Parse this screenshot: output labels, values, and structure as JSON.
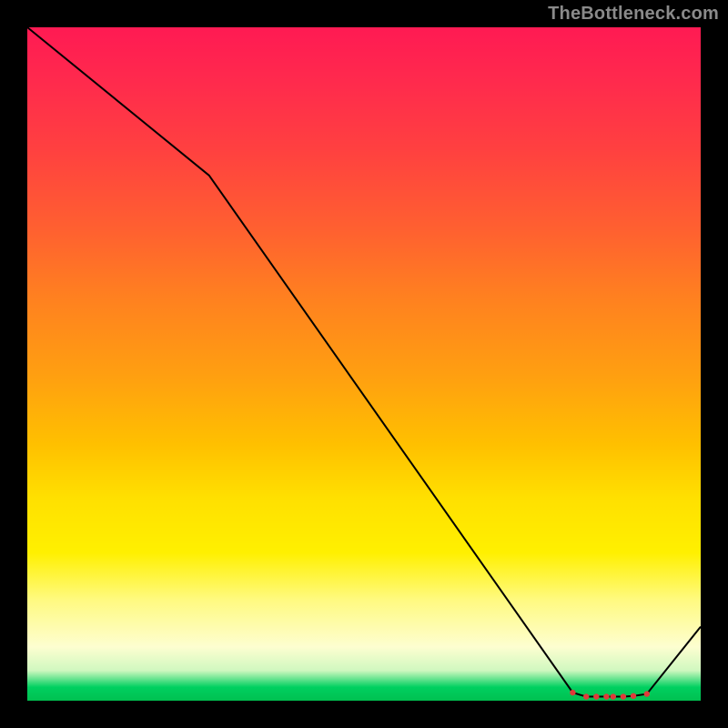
{
  "watermark": "TheBottleneck.com",
  "chart_data": {
    "type": "line",
    "title": "",
    "xlabel": "",
    "ylabel": "",
    "xlim": [
      0,
      100
    ],
    "ylim": [
      0,
      100
    ],
    "grid": false,
    "series": [
      {
        "name": "curve",
        "x": [
          0,
          27,
          81,
          83,
          84.5,
          86,
          87,
          88.5,
          90,
          92,
          100
        ],
        "y": [
          100,
          78,
          1.2,
          0.6,
          0.6,
          0.6,
          0.6,
          0.6,
          0.7,
          1.0,
          11
        ]
      }
    ],
    "markers": {
      "x": [
        81,
        83,
        84.5,
        86,
        87,
        88.5,
        90,
        92
      ],
      "y": [
        1.2,
        0.6,
        0.6,
        0.6,
        0.6,
        0.6,
        0.7,
        1.0
      ],
      "color": "#e03a3a",
      "radius": 3.2
    },
    "line_color": "#000000",
    "line_width": 2
  }
}
